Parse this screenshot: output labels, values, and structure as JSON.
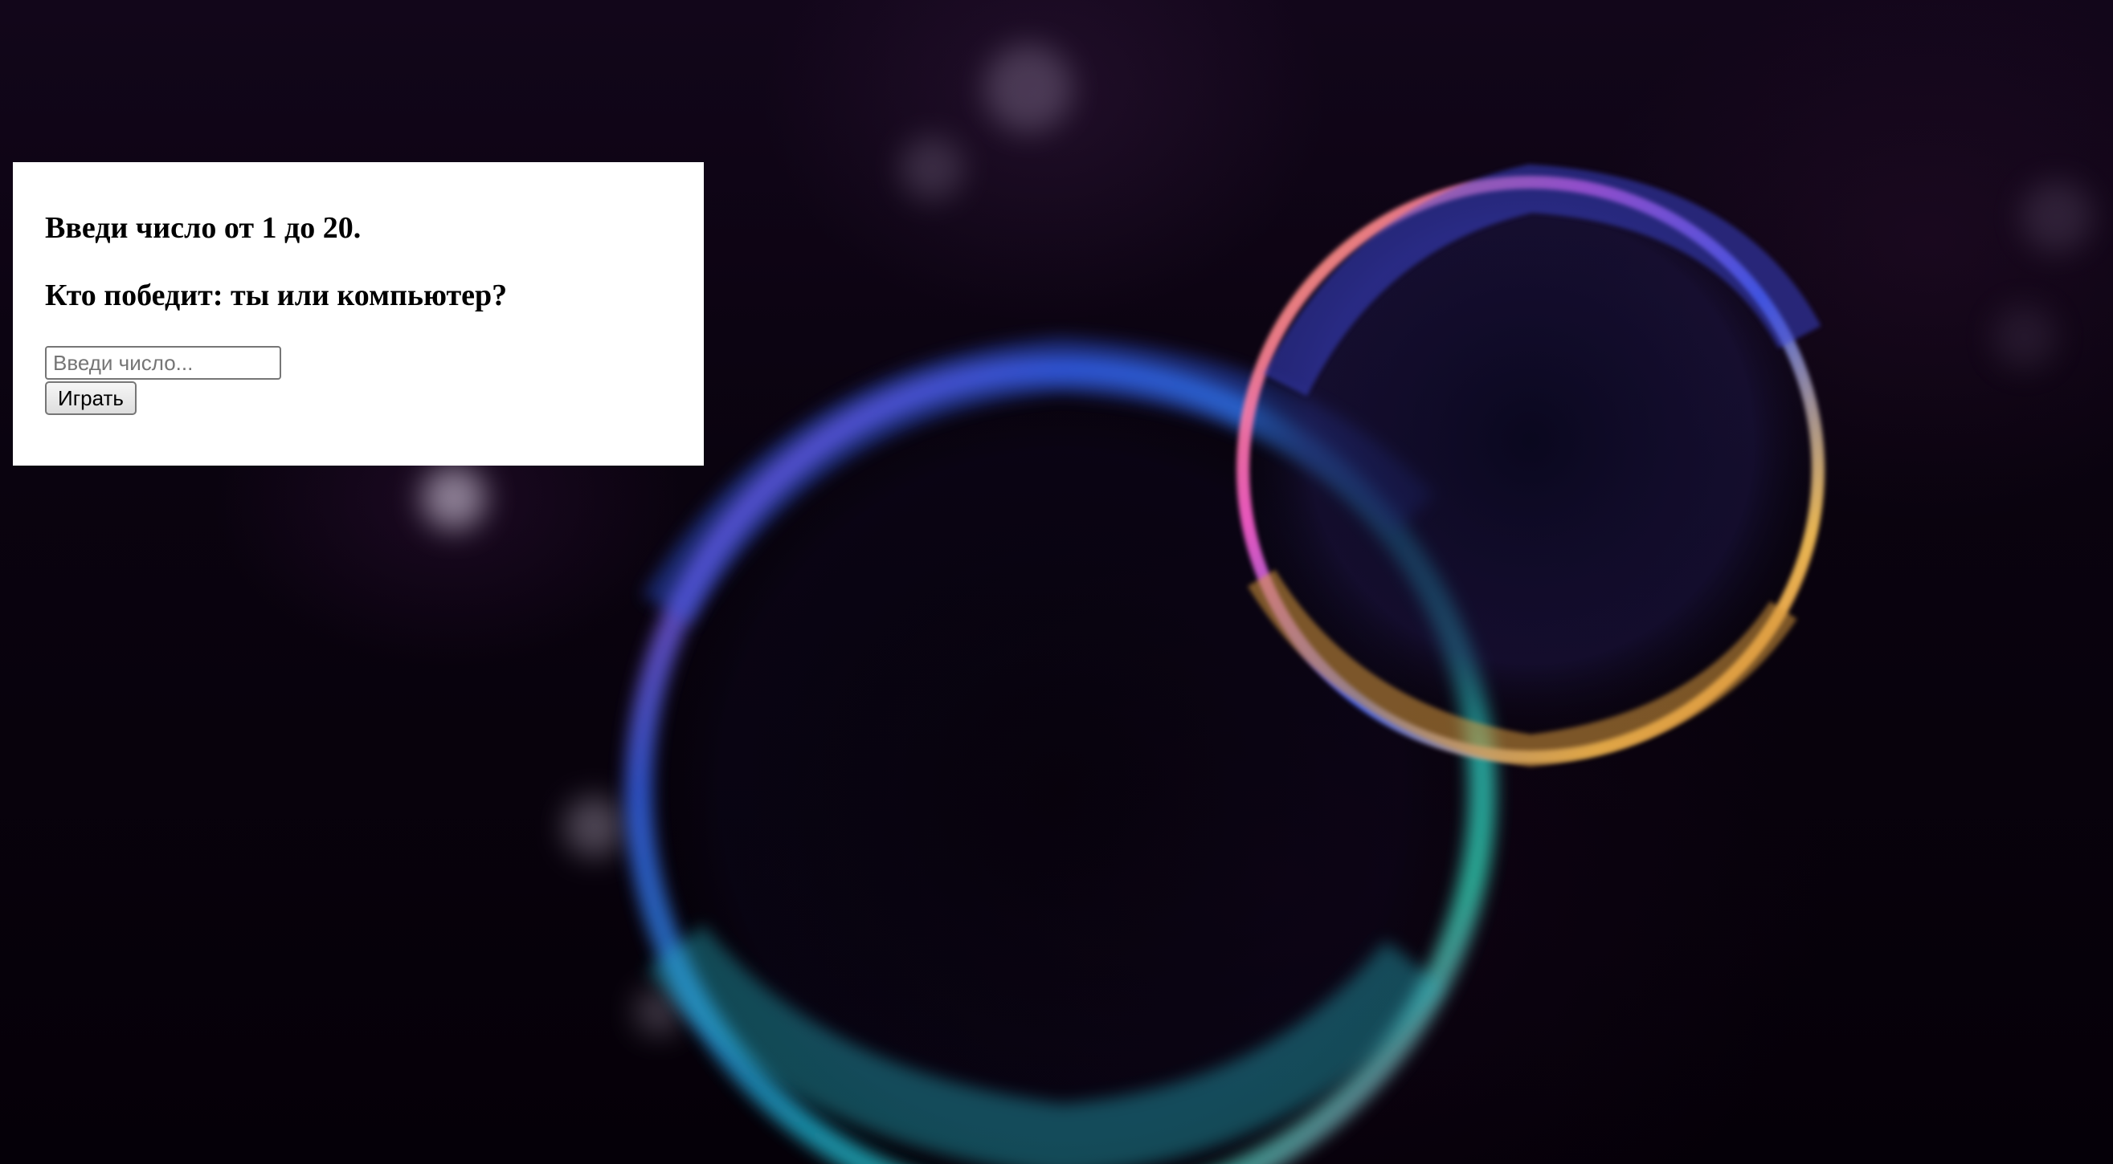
{
  "game": {
    "line1": "Введи число от 1 до 20.",
    "line2": "Кто победит: ты или компьютер?",
    "input_placeholder": "Введи число...",
    "play_label": "Играть"
  },
  "background": {
    "description_icon": "soap-bubbles-photo"
  }
}
